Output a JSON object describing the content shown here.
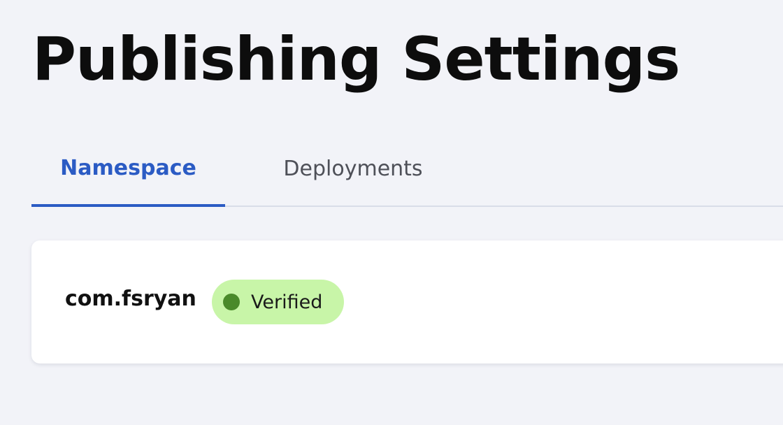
{
  "header": {
    "title": "Publishing Settings"
  },
  "tabs": [
    {
      "label": "Namespace",
      "active": true
    },
    {
      "label": "Deployments",
      "active": false
    }
  ],
  "namespace_card": {
    "name": "com.fsryan",
    "status": {
      "label": "Verified",
      "icon": "status-dot-icon",
      "color": "#4a8a2a",
      "background": "#c8f5a8"
    }
  },
  "colors": {
    "accent": "#2b5bc4",
    "page_background": "#f2f3f8"
  }
}
